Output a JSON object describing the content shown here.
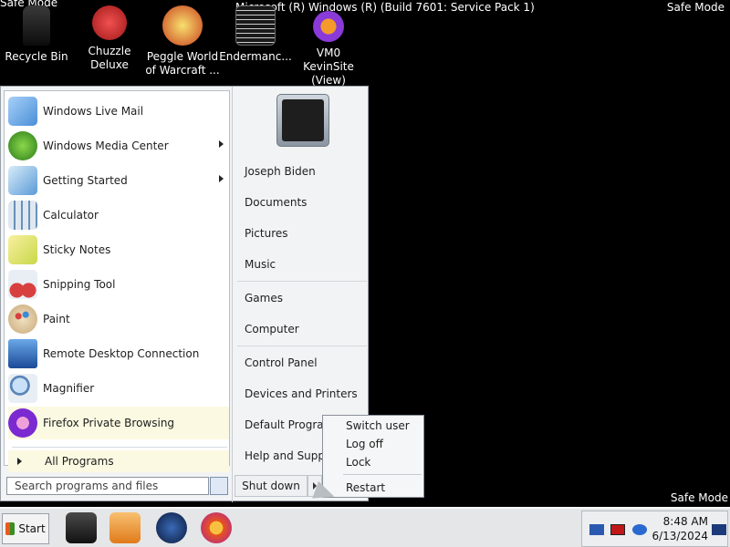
{
  "desktop": {
    "safe_mode_label": "Safe Mode",
    "safe_mode_partial": "Safe Mode",
    "build_info": "Microsoft (R) Windows (R) (Build 7601: Service Pack 1)",
    "icons": [
      {
        "name": "recycle-bin",
        "label": "Recycle Bin",
        "icon": "recycle-bin-icon",
        "color": "#1c1c1c"
      },
      {
        "name": "chuzzle",
        "label": "Chuzzle Deluxe",
        "icon": "chuzzle-icon",
        "color": "#d8282a"
      },
      {
        "name": "peggle",
        "label": "Peggle World of Warcraft ...",
        "icon": "peggle-icon",
        "color": "#e3a21c"
      },
      {
        "name": "endermanch",
        "label": "Endermanc...",
        "icon": "document-icon",
        "color": "#2a2a2a"
      },
      {
        "name": "vm0-kevinsite",
        "label": "VM0 KevinSite (View)",
        "icon": "firefox-icon",
        "color": "#8a3ad8"
      }
    ]
  },
  "start_menu": {
    "programs": [
      {
        "label": "Windows Live Mail",
        "icon": "mail-icon",
        "color": "#4a8fd8",
        "submenu": false
      },
      {
        "label": "Windows Media Center",
        "icon": "media-center-icon",
        "color": "#3c9a2c",
        "submenu": true
      },
      {
        "label": "Getting Started",
        "icon": "getting-started-icon",
        "color": "#5a9ad8",
        "submenu": true
      },
      {
        "label": "Calculator",
        "icon": "calculator-icon",
        "color": "#6a8fb8",
        "submenu": false
      },
      {
        "label": "Sticky Notes",
        "icon": "sticky-notes-icon",
        "color": "#e8d85a",
        "submenu": false
      },
      {
        "label": "Snipping Tool",
        "icon": "scissors-icon",
        "color": "#c84040",
        "submenu": false
      },
      {
        "label": "Paint",
        "icon": "paint-icon",
        "color": "#d88a3a",
        "submenu": false
      },
      {
        "label": "Remote Desktop Connection",
        "icon": "remote-desktop-icon",
        "color": "#2a6ab8",
        "submenu": false
      },
      {
        "label": "Magnifier",
        "icon": "magnifier-icon",
        "color": "#5a86b8",
        "submenu": false
      },
      {
        "label": "Firefox Private Browsing",
        "icon": "firefox-private-icon",
        "color": "#7a2ad0",
        "submenu": false
      }
    ],
    "all_programs": "All Programs",
    "search_placeholder": "Search programs and files",
    "user_name": "Joseph Biden",
    "right_links": [
      "Documents",
      "Pictures",
      "Music",
      "Games",
      "Computer",
      "Control Panel",
      "Devices and Printers",
      "Default Programs",
      "Help and Support"
    ],
    "shutdown_label": "Shut down",
    "power_menu": [
      "Switch user",
      "Log off",
      "Lock",
      "Restart"
    ]
  },
  "taskbar": {
    "start_label": "Start",
    "apps": [
      {
        "name": "taskbar-app-1",
        "icon": "printer-icon",
        "color": "#222222"
      },
      {
        "name": "taskbar-app-2",
        "icon": "media-player-icon",
        "color": "#e88a2a"
      },
      {
        "name": "taskbar-app-3",
        "icon": "globe-icon",
        "color": "#1a3a6a"
      },
      {
        "name": "taskbar-app-4",
        "icon": "firefox-icon",
        "color": "#e8551c"
      }
    ],
    "time": "8:48 AM",
    "date": "6/13/2024"
  }
}
